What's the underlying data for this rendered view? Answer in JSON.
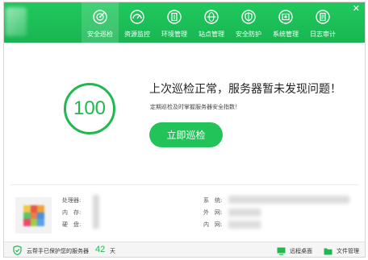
{
  "colors": {
    "brand_green": "#21b84f",
    "topbar": "#1bbd56"
  },
  "nav": {
    "items": [
      {
        "label": "安全巡检",
        "icon": "radar-icon",
        "active": true
      },
      {
        "label": "资源监控",
        "icon": "gauge-icon",
        "active": false
      },
      {
        "label": "环境管理",
        "icon": "building-icon",
        "active": false
      },
      {
        "label": "站点管理",
        "icon": "globe-icon",
        "active": false
      },
      {
        "label": "安全防护",
        "icon": "shield-icon",
        "active": false
      },
      {
        "label": "系统管理",
        "icon": "settings-screen-icon",
        "active": false
      },
      {
        "label": "日志审计",
        "icon": "document-icon",
        "active": false
      }
    ]
  },
  "main": {
    "score": "100",
    "title": "上次巡检正常，服务器暂未发现问题！",
    "subtitle": "定期巡检及时掌握服务器安全指数！",
    "inspect_button": "立即巡检"
  },
  "server_info": {
    "cpu_label": "处理器:",
    "memory_label": "内　存:",
    "disk_label": "硬　盘:",
    "os_label": "系　统:",
    "public_ip_label": "外　网:",
    "private_ip_label": "内　网:"
  },
  "footer": {
    "protect_text": "云帮手已保护您的服务器",
    "days": "42",
    "days_unit": "天",
    "remote_desktop": "远程桌面",
    "file_manager": "文件管理"
  }
}
